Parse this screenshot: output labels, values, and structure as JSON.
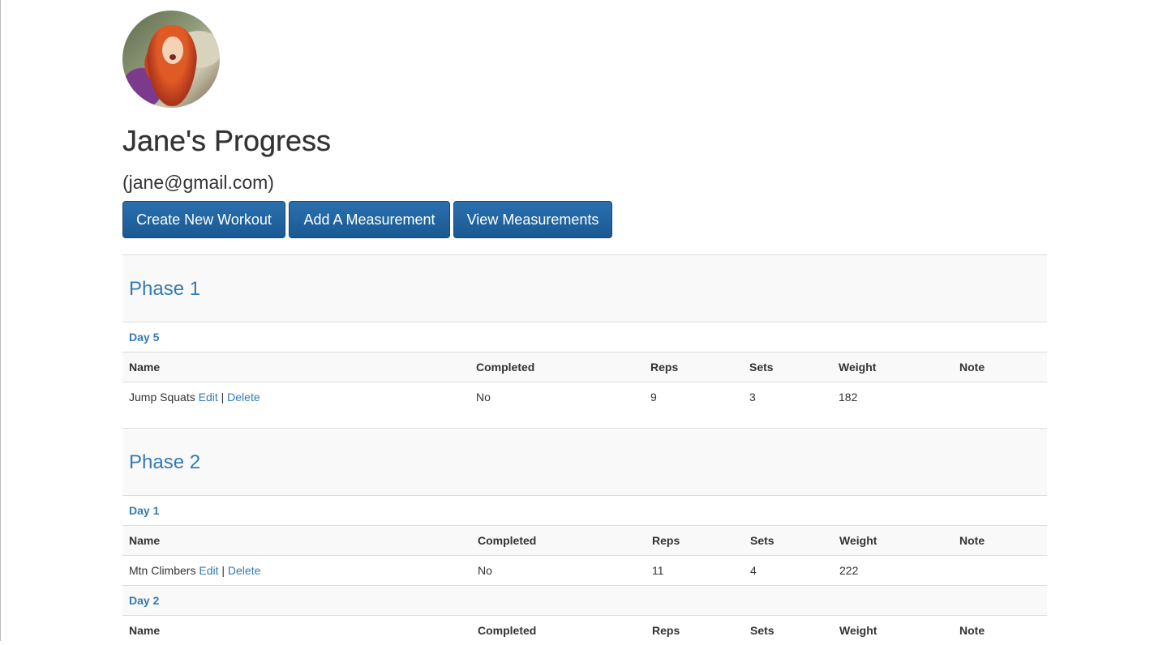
{
  "profile": {
    "title": "Jane's Progress",
    "email": "(jane@gmail.com)"
  },
  "actions": {
    "create_workout": "Create New Workout",
    "add_measurement": "Add A Measurement",
    "view_measurements": "View Measurements"
  },
  "columns": [
    "Name",
    "Completed",
    "Reps",
    "Sets",
    "Weight",
    "Note"
  ],
  "links": {
    "edit": "Edit",
    "separator": "|",
    "delete": "Delete"
  },
  "phases": [
    {
      "title": "Phase 1",
      "days": [
        {
          "label": "Day 5",
          "rows": [
            {
              "name": "Jump Squats",
              "completed": "No",
              "reps": "9",
              "sets": "3",
              "weight": "182",
              "note": ""
            }
          ]
        }
      ]
    },
    {
      "title": "Phase 2",
      "days": [
        {
          "label": "Day 1",
          "rows": [
            {
              "name": "Mtn Climbers",
              "completed": "No",
              "reps": "11",
              "sets": "4",
              "weight": "222",
              "note": ""
            }
          ]
        },
        {
          "label": "Day 2",
          "rows": []
        }
      ]
    }
  ],
  "colors": {
    "link": "#337ab7",
    "button": "#1f63a0",
    "stripe": "#f9f9f9"
  }
}
